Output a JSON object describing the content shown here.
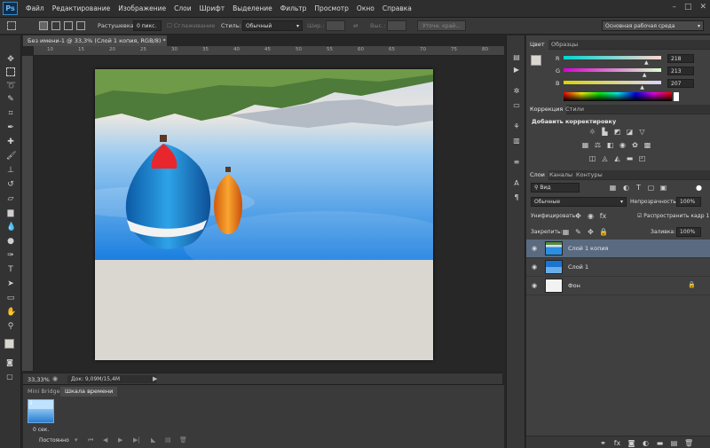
{
  "app": {
    "logo": "Ps"
  },
  "menu": [
    "Файл",
    "Редактирование",
    "Изображение",
    "Слои",
    "Шрифт",
    "Выделение",
    "Фильтр",
    "Просмотр",
    "Окно",
    "Справка"
  ],
  "window_controls": [
    "–",
    "□",
    "✕"
  ],
  "options_bar": {
    "feather_label": "Растушевка:",
    "feather_value": "0 пикс.",
    "antialias_label": "Сглаживание",
    "style_label": "Стиль:",
    "style_value": "Обычный",
    "width_label": "Шир.:",
    "height_label": "Выс.:",
    "refine_button": "Уточн. край...",
    "workspace": "Основная рабочая среда"
  },
  "document": {
    "tab_title": "Без имени-1 @ 33,3% (Слой 1 копия, RGB/8) *",
    "ruler_ticks": [
      "10",
      "15",
      "20",
      "25",
      "30",
      "35",
      "40",
      "45",
      "50",
      "55",
      "60",
      "65",
      "70",
      "75",
      "80"
    ],
    "zoom": "33,33%",
    "doc_info": "Док: 9,09M/15,4M"
  },
  "timeline": {
    "tabs": [
      "Mini Bridge",
      "Шкала времени"
    ],
    "frame_number": "1",
    "frame_time": "0 сек.",
    "loop": "Постоянно"
  },
  "color_panel": {
    "tabs": [
      "Цвет",
      "Образцы"
    ],
    "r_label": "R",
    "r_value": "218",
    "g_label": "G",
    "g_value": "213",
    "b_label": "B",
    "b_value": "207",
    "r_level": 218,
    "g_level": 213,
    "b_level": 207
  },
  "adjustments_panel": {
    "tabs": [
      "Коррекция",
      "Стили"
    ],
    "heading": "Добавить корректировку"
  },
  "layers_panel": {
    "tabs": [
      "Слои",
      "Каналы",
      "Контуры"
    ],
    "filter_kind": "Вид",
    "blend_mode": "Обычные",
    "opacity_label": "Непрозрачность:",
    "opacity_value": "100%",
    "unify_label": "Унифицировать:",
    "propagate_label": "Распространить кадр 1",
    "lock_label": "Закрепить:",
    "fill_label": "Заливка:",
    "fill_value": "100%",
    "layers": [
      {
        "name": "Слой 1 копия",
        "selected": true
      },
      {
        "name": "Слой 1",
        "selected": false
      },
      {
        "name": "Фон",
        "selected": false
      }
    ]
  },
  "colors": {
    "accent_selection": "#5a6a80",
    "canvas_beige": "#dad7d1",
    "panel_bg": "#404040"
  }
}
